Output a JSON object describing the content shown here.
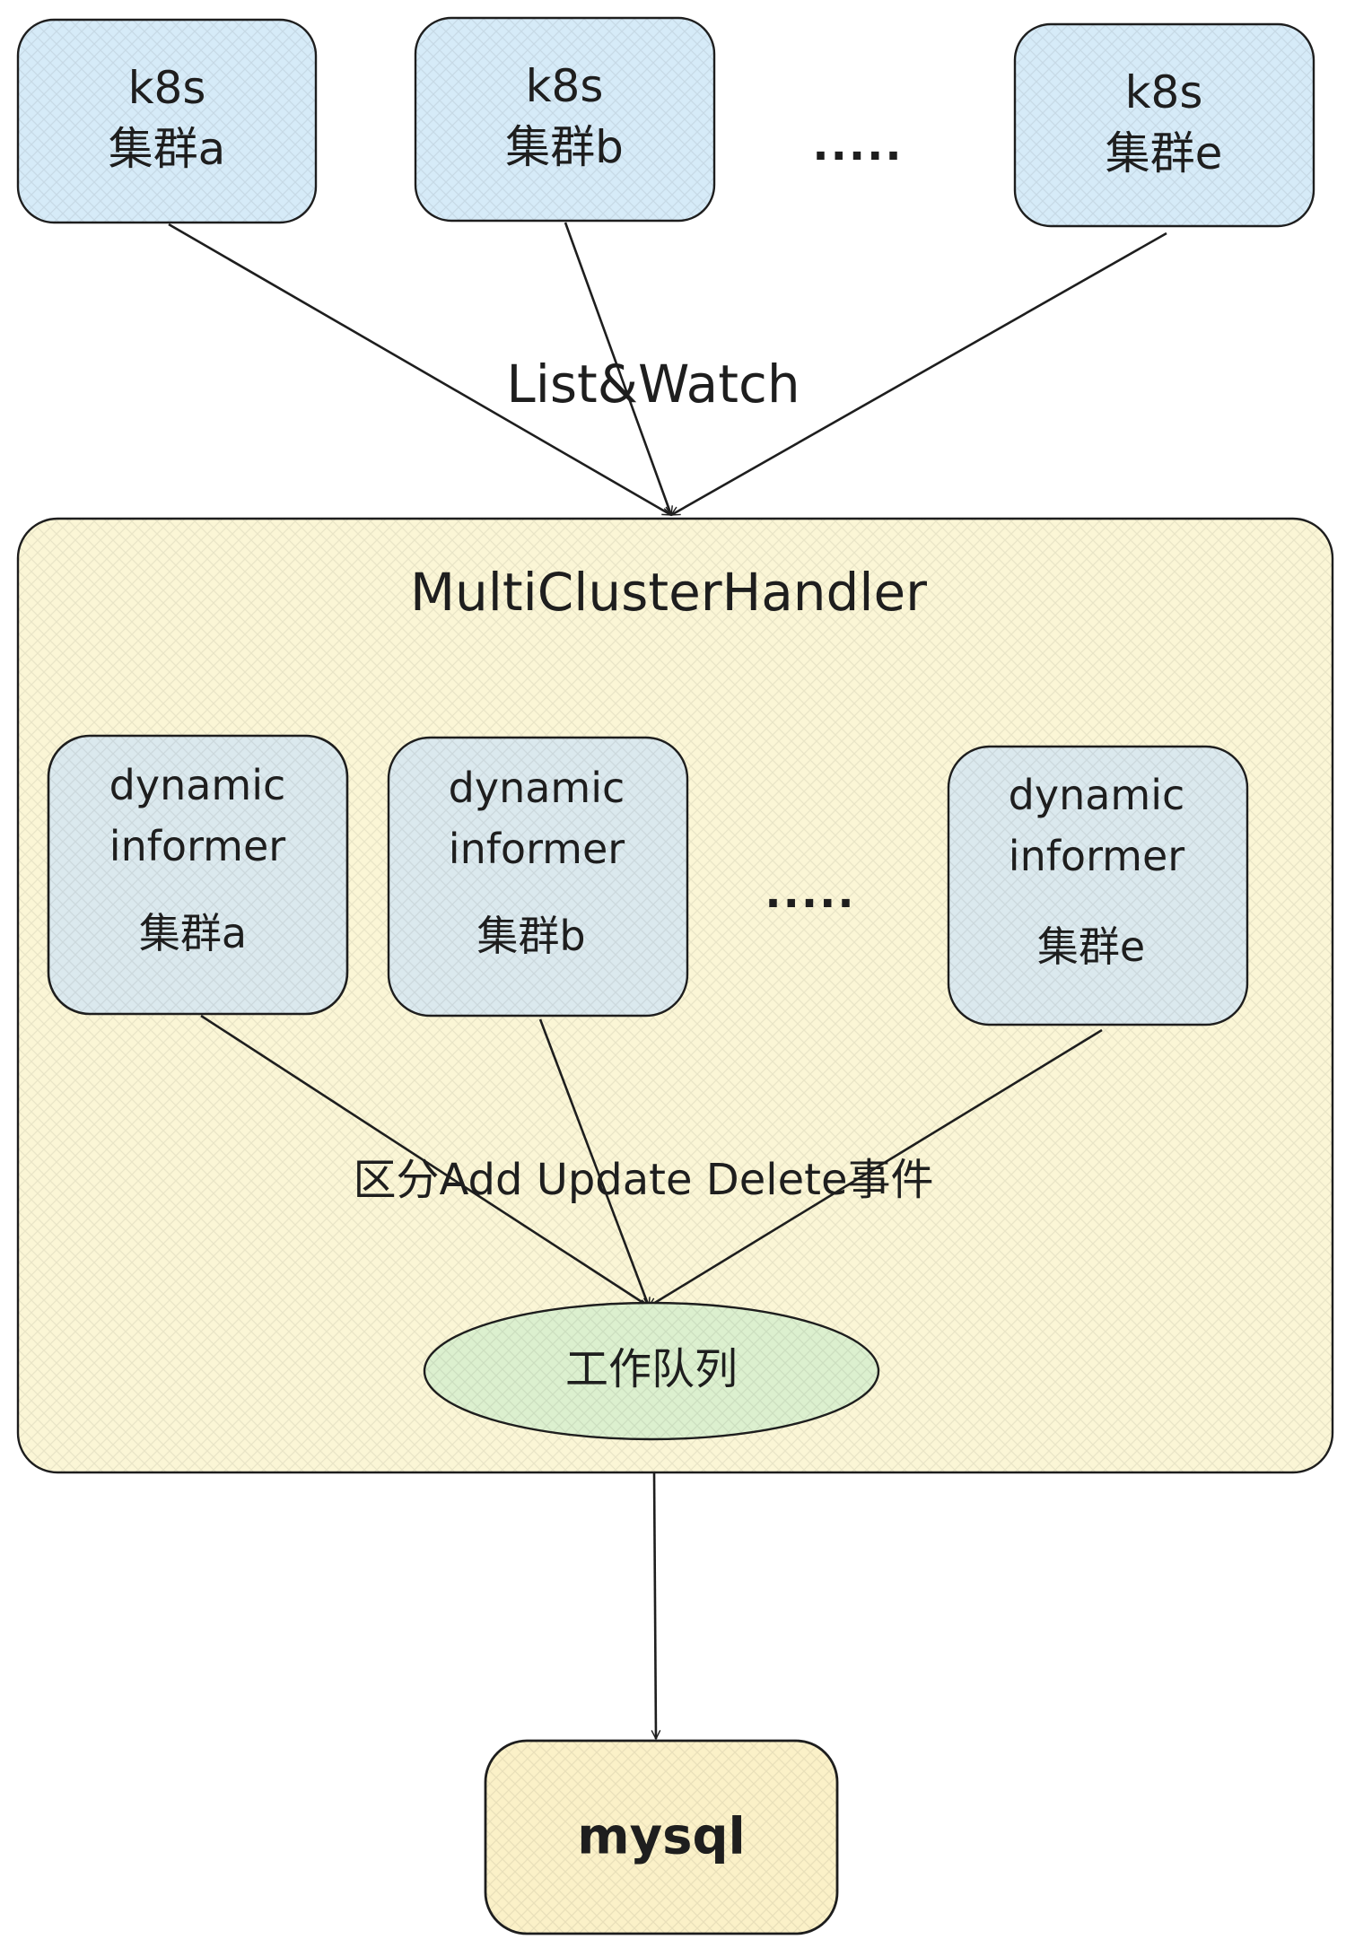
{
  "clusters": [
    {
      "line1": "k8s",
      "line2": "集群a"
    },
    {
      "line1": "k8s",
      "line2": "集群b"
    },
    {
      "line1": "k8s",
      "line2": "集群e"
    }
  ],
  "top_ellipsis": ".....",
  "list_watch_label": "List&Watch",
  "handler": {
    "title": "MultiClusterHandler",
    "informers": [
      {
        "line1": "dynamic",
        "line2": "informer",
        "line3": "集群a"
      },
      {
        "line1": "dynamic",
        "line2": "informer",
        "line3": "集群b"
      },
      {
        "line1": "dynamic",
        "line2": "informer",
        "line3": "集群e"
      }
    ],
    "informer_ellipsis": ".....",
    "event_label": "区分Add Update Delete事件",
    "queue_label": "工作队列"
  },
  "database_label": "mysql",
  "colors": {
    "cluster_fill": "#d6ebf8",
    "handler_fill": "#fbf6d6",
    "informer_fill": "#dbe9ee",
    "queue_fill": "#dcf0cf",
    "db_fill": "#fbf1c8",
    "stroke": "#1e1e1e"
  }
}
